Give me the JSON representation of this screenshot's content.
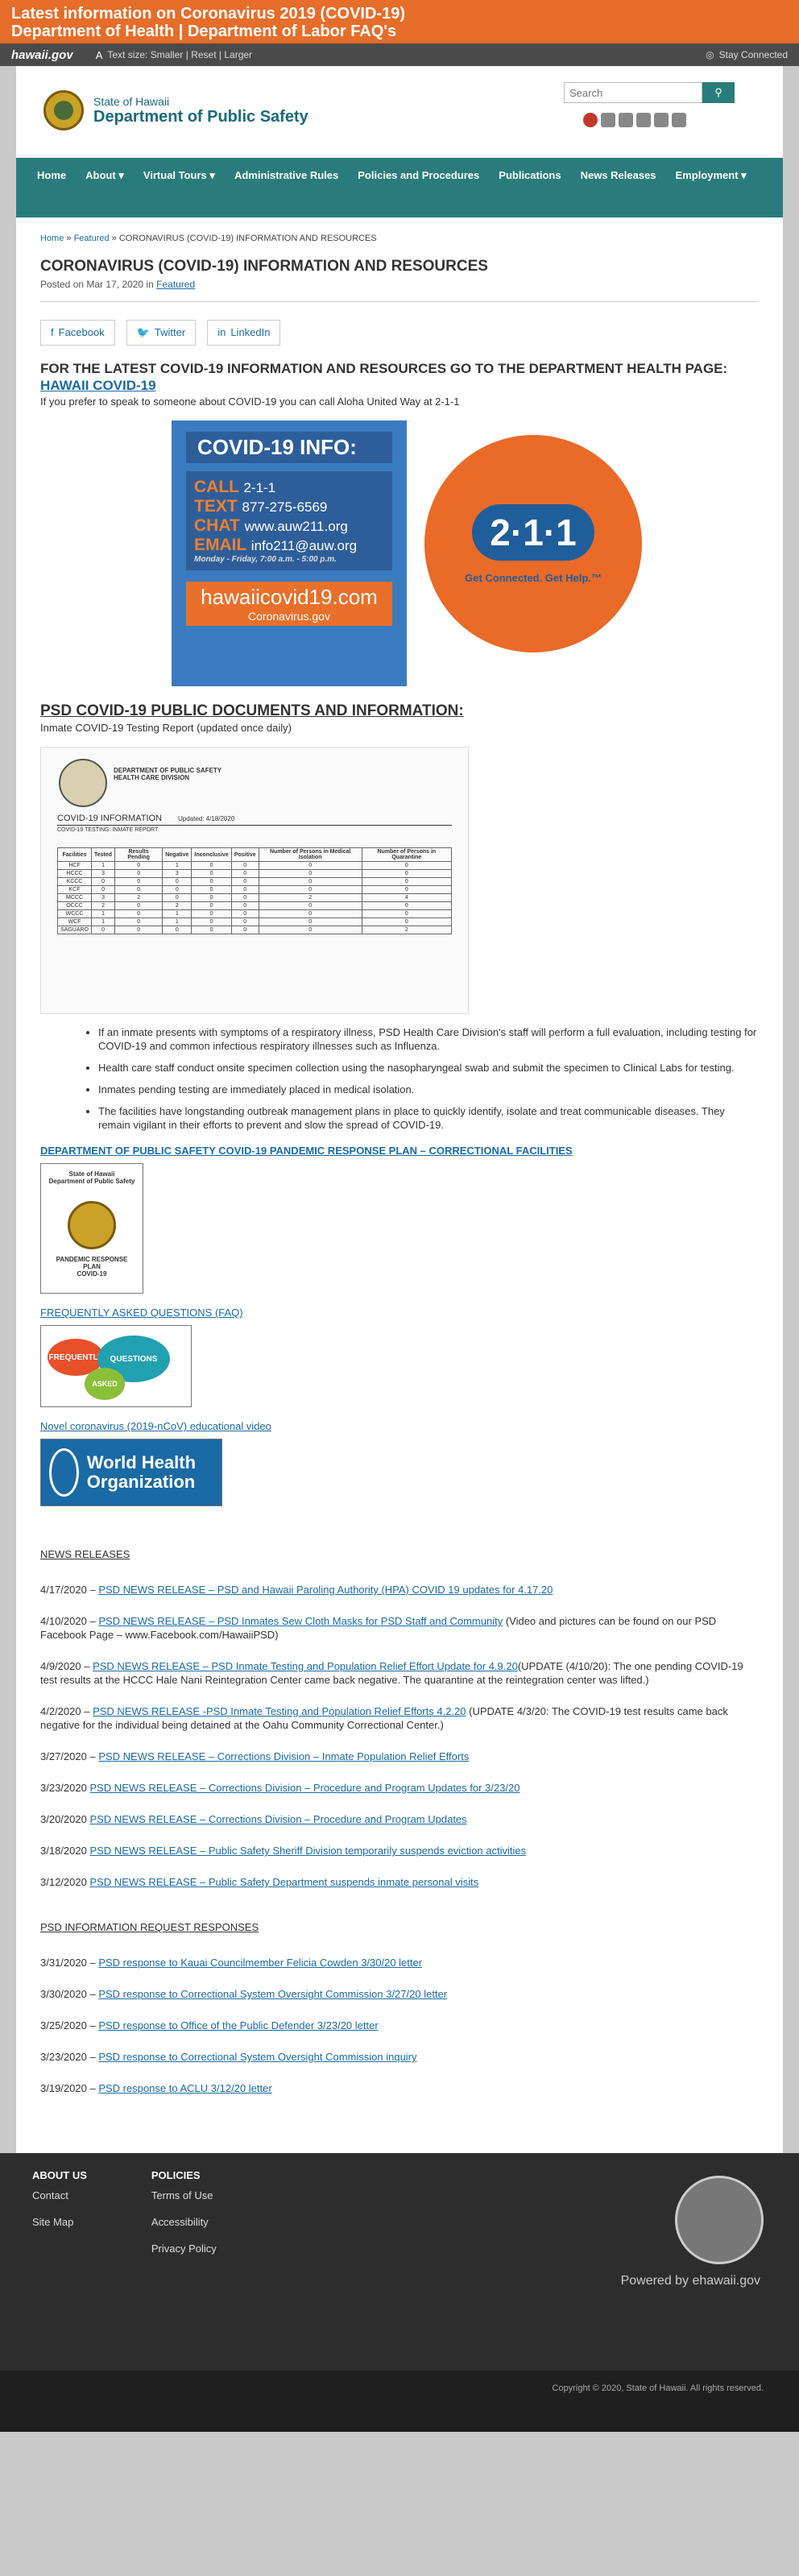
{
  "alert": {
    "line1": "Latest information on Coronavirus 2019 (COVID-19)",
    "line2": "Department of Health | Department of Labor FAQ's"
  },
  "govbar": {
    "logo": "hawaii.gov",
    "text_size_label": "Text size:",
    "smaller": "Smaller",
    "reset": "Reset",
    "larger": "Larger",
    "stay": "Stay Connected"
  },
  "header": {
    "state": "State of Hawaii",
    "dept": "Department of Public Safety",
    "search_placeholder": "Search"
  },
  "nav": [
    "Home",
    "About ▾",
    "Virtual Tours ▾",
    "Administrative Rules",
    "Policies and Procedures",
    "Publications",
    "News Releases",
    "Employment ▾"
  ],
  "breadcrumb": {
    "home": "Home",
    "featured": "Featured",
    "current": "CORONAVIRUS (COVID-19) INFORMATION AND RESOURCES"
  },
  "article": {
    "title": "CORONAVIRUS (COVID-19) INFORMATION AND RESOURCES",
    "posted_prefix": "Posted on Mar 17, 2020 in",
    "posted_cat": "Featured",
    "share": [
      "Facebook",
      "Twitter",
      "LinkedIn"
    ],
    "headline": "FOR THE LATEST COVID-19 INFORMATION AND RESOURCES GO TO THE DEPARTMENT HEALTH PAGE:",
    "headline_link": "HAWAII COVID-19",
    "aloha": "If you prefer to speak to someone about COVID-19 you can call Aloha United Way at 2-1-1",
    "img": {
      "title": "COVID-19 INFO:",
      "call": "CALL",
      "call_v": "2-1-1",
      "text": "TEXT",
      "text_v": "877-275-6569",
      "chat": "CHAT",
      "chat_v": "www.auw211.org",
      "email": "EMAIL",
      "email_v": "info211@auw.org",
      "hours": "Monday - Friday, 7:00 a.m. - 5:00 p.m.",
      "web": "hawaiicovid19.com",
      "web2": "Coronavirus.gov",
      "num": "2·1·1",
      "get": "Get Connected. Get Help.™"
    },
    "docs_title": "PSD COVID-19 PUBLIC DOCUMENTS AND INFORMATION:",
    "inmate_report": "Inmate COVID-19 Testing Report (updated once daily)",
    "report": {
      "dept": "DEPARTMENT OF PUBLIC SAFETY",
      "div": "HEALTH CARE DIVISION",
      "title": "COVID-19 INFORMATION",
      "updated": "Updated: 4/18/2020",
      "sub": "COVID-19 TESTING: INMATE REPORT",
      "cols": [
        "Facilities",
        "Tested",
        "Results Pending",
        "Negative",
        "Inconclusive",
        "Positive",
        "Number of Persons in Medical Isolation",
        "Number of Persons in Quarantine"
      ],
      "rows": [
        [
          "HCF",
          "1",
          "0",
          "1",
          "0",
          "0",
          "0",
          "0"
        ],
        [
          "HCCC",
          "3",
          "0",
          "3",
          "0",
          "0",
          "0",
          "0"
        ],
        [
          "KCCC",
          "0",
          "0",
          "0",
          "0",
          "0",
          "0",
          "0"
        ],
        [
          "KCF",
          "0",
          "0",
          "0",
          "0",
          "0",
          "0",
          "0"
        ],
        [
          "MCCC",
          "3",
          "2",
          "0",
          "0",
          "0",
          "2",
          "4"
        ],
        [
          "OCCC",
          "2",
          "0",
          "2",
          "0",
          "0",
          "0",
          "0"
        ],
        [
          "WCCC",
          "1",
          "0",
          "1",
          "0",
          "0",
          "0",
          "0"
        ],
        [
          "WCF",
          "1",
          "0",
          "1",
          "0",
          "0",
          "0",
          "0"
        ],
        [
          "SAGUARO",
          "0",
          "0",
          "0",
          "0",
          "0",
          "0",
          "2"
        ]
      ]
    },
    "bullets": [
      "If an inmate presents with symptoms of a respiratory illness, PSD Health Care Division's staff will perform a full evaluation, including testing for COVID-19 and common infectious respiratory illnesses such as Influenza.",
      "Health care staff conduct onsite specimen collection using the nasopharyngeal swab and submit the specimen to Clinical Labs for testing.",
      "Inmates pending testing are immediately placed in medical isolation.",
      "The facilities have longstanding outbreak management plans in place to quickly identify, isolate and treat communicable diseases.  They remain vigilant in their efforts to prevent and slow the spread of COVID-19."
    ],
    "plan_link": "DEPARTMENT OF PUBLIC SAFETY COVID-19 PANDEMIC RESPONSE PLAN – CORRECTIONAL FACILITIES",
    "plan_img": {
      "t1": "State of Hawaii",
      "t2": "Department of Public Safety",
      "t3": "PANDEMIC RESPONSE PLAN",
      "t4": "COVID-19"
    },
    "faq_link": "FREQUENTLY ASKED QUESTIONS (FAQ)",
    "faq_img": {
      "a": "FREQUENTLY",
      "b": "QUESTIONS",
      "c": "ASKED"
    },
    "video_link": "Novel coronavirus (2019-nCoV) educational video",
    "who": "World Health Organization"
  },
  "news": {
    "title": "NEWS RELEASES",
    "items": [
      {
        "d": "4/17/2020 –",
        "l": "PSD NEWS RELEASE – PSD and Hawaii Paroling Authority (HPA) COVID 19 updates for 4.17.20",
        "t": ""
      },
      {
        "d": "4/10/2020 –",
        "l": "PSD NEWS RELEASE – PSD Inmates Sew Cloth Masks for PSD Staff and Community",
        "t": "  (Video and pictures can be found on our PSD Facebook Page – www.Facebook.com/HawaiiPSD)"
      },
      {
        "d": "4/9/2020 –",
        "l": "PSD NEWS RELEASE – PSD Inmate Testing and Population Relief Effort Update for 4.9.20",
        "t": "(UPDATE (4/10/20): The one pending COVID-19 test results at the HCCC Hale Nani Reintegration Center came back negative.  The quarantine at the reintegration center was lifted.)"
      },
      {
        "d": "4/2/2020 –",
        "l": "PSD NEWS RELEASE -PSD Inmate Testing and Population Relief Efforts 4.2.20",
        "t": "      (UPDATE 4/3/20: The COVID-19 test results came back negative for the individual being detained at the Oahu Community Correctional Center.)"
      },
      {
        "d": "3/27/2020 –",
        "l": "PSD NEWS RELEASE – Corrections Division – Inmate Population Relief Efforts",
        "t": ""
      },
      {
        "d": "3/23/2020",
        "l": "PSD NEWS RELEASE – Corrections Division – Procedure and Program Updates for 3/23/20",
        "t": ""
      },
      {
        "d": "3/20/2020",
        "l": "PSD NEWS RELEASE – Corrections Division – Procedure and Program Updates",
        "t": ""
      },
      {
        "d": "3/18/2020",
        "l": "PSD NEWS RELEASE – Public Safety Sheriff Division temporarily suspends eviction activities",
        "t": ""
      },
      {
        "d": "3/12/2020",
        "l": "PSD NEWS RELEASE – Public Safety Department suspends inmate personal visits",
        "t": ""
      }
    ]
  },
  "requests": {
    "title": "PSD INFORMATION REQUEST RESPONSES",
    "items": [
      {
        "d": "3/31/2020 –",
        "l": "PSD response to Kauai Councilmember Felicia Cowden 3/30/20 letter"
      },
      {
        "d": "3/30/2020 –",
        "l": "PSD response to Correctional System Oversight Commission 3/27/20 letter"
      },
      {
        "d": "3/25/2020 –",
        "l": "PSD response to Office of the Public Defender 3/23/20 letter"
      },
      {
        "d": "3/23/2020 –",
        "l": "PSD response to Correctional System Oversight Commission inquiry"
      },
      {
        "d": "3/19/2020 –",
        "l": "PSD response to ACLU 3/12/20 letter"
      }
    ]
  },
  "footer": {
    "about": "ABOUT US",
    "about_items": [
      "Contact",
      "Site Map"
    ],
    "policies": "POLICIES",
    "policy_items": [
      "Terms of Use",
      "Accessibility",
      "Privacy Policy"
    ],
    "powered": "Powered by ehawaii.gov",
    "copyright": "Copyright © 2020, State of Hawaii. All rights reserved."
  }
}
